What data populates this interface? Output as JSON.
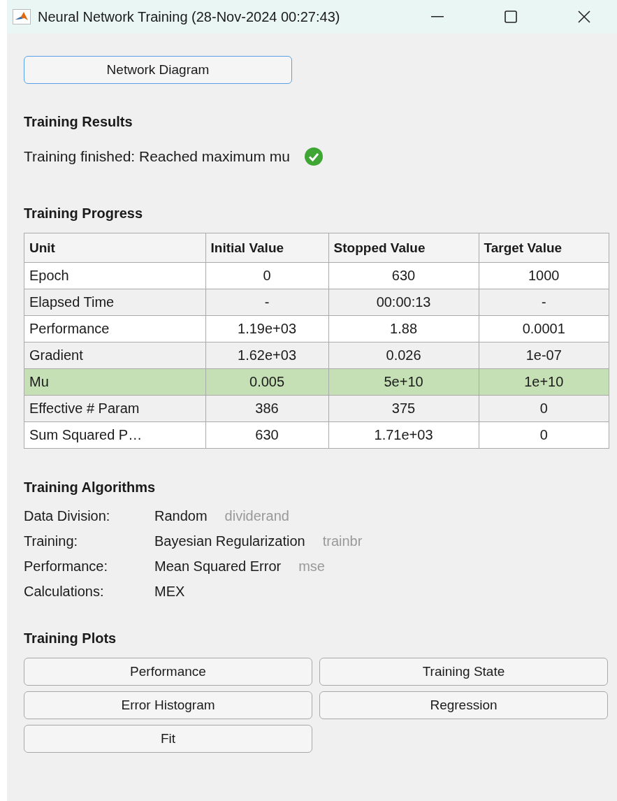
{
  "window": {
    "title": "Neural Network Training (28-Nov-2024 00:27:43)"
  },
  "diagram_button": "Network Diagram",
  "results": {
    "heading": "Training Results",
    "message": "Training finished: Reached maximum mu"
  },
  "progress": {
    "heading": "Training Progress",
    "columns": [
      "Unit",
      "Initial Value",
      "Stopped Value",
      "Target Value"
    ],
    "rows": [
      {
        "cells": [
          "Epoch",
          "0",
          "630",
          "1000"
        ],
        "highlighted": false
      },
      {
        "cells": [
          "Elapsed Time",
          "-",
          "00:00:13",
          "-"
        ],
        "highlighted": false
      },
      {
        "cells": [
          "Performance",
          "1.19e+03",
          "1.88",
          "0.0001"
        ],
        "highlighted": false
      },
      {
        "cells": [
          "Gradient",
          "1.62e+03",
          "0.026",
          "1e-07"
        ],
        "highlighted": false
      },
      {
        "cells": [
          "Mu",
          "0.005",
          "5e+10",
          "1e+10"
        ],
        "highlighted": true
      },
      {
        "cells": [
          "Effective # Param",
          "386",
          "375",
          "0"
        ],
        "highlighted": false
      },
      {
        "cells": [
          "Sum Squared P…",
          "630",
          "1.71e+03",
          "0"
        ],
        "highlighted": false
      }
    ]
  },
  "algorithms": {
    "heading": "Training Algorithms",
    "rows": [
      {
        "label": "Data Division:",
        "value": "Random",
        "function": "dividerand"
      },
      {
        "label": "Training:",
        "value": "Bayesian Regularization",
        "function": "trainbr"
      },
      {
        "label": "Performance:",
        "value": "Mean Squared Error",
        "function": "mse"
      },
      {
        "label": "Calculations:",
        "value": "MEX"
      }
    ]
  },
  "plots": {
    "heading": "Training Plots",
    "buttons": [
      "Performance",
      "Training State",
      "Error Histogram",
      "Regression",
      "Fit"
    ]
  }
}
